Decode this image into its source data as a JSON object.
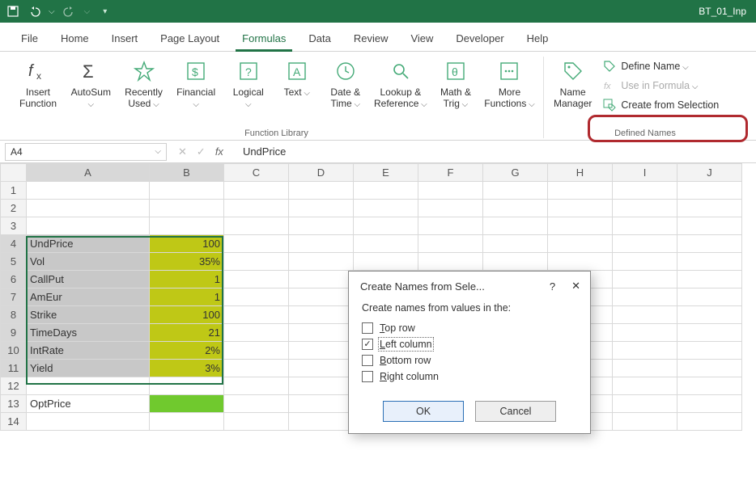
{
  "titlebar": {
    "doc_name": "BT_01_Inp"
  },
  "tabs": {
    "file": "File",
    "home": "Home",
    "insert": "Insert",
    "page_layout": "Page Layout",
    "formulas": "Formulas",
    "data": "Data",
    "review": "Review",
    "view": "View",
    "developer": "Developer",
    "help": "Help"
  },
  "ribbon": {
    "insert_function": "Insert\nFunction",
    "autosum": "AutoSum",
    "recently_used": "Recently\nUsed",
    "financial": "Financial",
    "logical": "Logical",
    "text": "Text",
    "date_time": "Date &\nTime",
    "lookup_ref": "Lookup &\nReference",
    "math_trig": "Math &\nTrig",
    "more_functions": "More\nFunctions",
    "name_manager": "Name\nManager",
    "define_name": "Define Name",
    "use_in_formula": "Use in Formula",
    "create_from_selection": "Create from Selection",
    "group_function_library": "Function Library",
    "group_defined_names": "Defined Names"
  },
  "namebox": {
    "value": "A4"
  },
  "formula_bar": {
    "value": "UndPrice"
  },
  "grid": {
    "columns": [
      "A",
      "B",
      "C",
      "D",
      "E",
      "F",
      "G",
      "H",
      "I",
      "J"
    ],
    "rows": [
      {
        "n": 1
      },
      {
        "n": 2
      },
      {
        "n": 3
      },
      {
        "n": 4,
        "a": "UndPrice",
        "b": "100"
      },
      {
        "n": 5,
        "a": "Vol",
        "b": "35%"
      },
      {
        "n": 6,
        "a": "CallPut",
        "b": "1"
      },
      {
        "n": 7,
        "a": "AmEur",
        "b": "1"
      },
      {
        "n": 8,
        "a": "Strike",
        "b": "100"
      },
      {
        "n": 9,
        "a": "TimeDays",
        "b": "21"
      },
      {
        "n": 10,
        "a": "IntRate",
        "b": "2%"
      },
      {
        "n": 11,
        "a": "Yield",
        "b": "3%"
      },
      {
        "n": 12
      },
      {
        "n": 13,
        "a": "OptPrice"
      },
      {
        "n": 14
      }
    ]
  },
  "dialog": {
    "title": "Create Names from Sele...",
    "help": "?",
    "lead": "Create names from values in the:",
    "top_row": "Top row",
    "left_column": "Left column",
    "bottom_row": "Bottom row",
    "right_column": "Right column",
    "ok": "OK",
    "cancel": "Cancel",
    "checked": {
      "top_row": false,
      "left_column": true,
      "bottom_row": false,
      "right_column": false
    }
  }
}
